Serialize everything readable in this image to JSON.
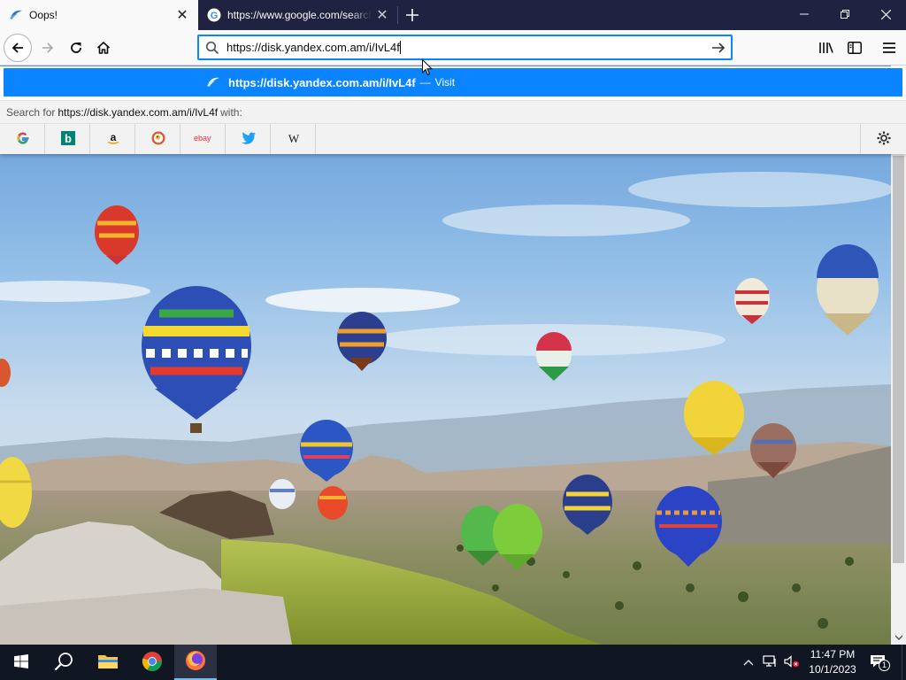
{
  "tabs": [
    {
      "title": "Oops!",
      "active": true
    },
    {
      "title": "https://www.google.com/search",
      "active": false
    }
  ],
  "navbar": {
    "url": "https://disk.yandex.com.am/i/IvL4f"
  },
  "dropdown": {
    "suggestion_url": "https://disk.yandex.com.am/i/IvL4f",
    "suggestion_separator": "—",
    "suggestion_action": "Visit",
    "search_prefix": "Search for",
    "search_term": "https://disk.yandex.com.am/i/IvL4f",
    "search_suffix": "with:",
    "engines": [
      "google-icon",
      "bing-icon",
      "amazon-icon",
      "duckduckgo-icon",
      "ebay-icon",
      "twitter-icon",
      "wikipedia-icon"
    ],
    "engine_glyphs": {
      "amazon": "a",
      "ebay": "ebay",
      "wikipedia": "W",
      "bing": "b"
    }
  },
  "taskbar": {
    "time": "11:47 PM",
    "date": "10/1/2023",
    "notification_count": "1"
  },
  "colors": {
    "accent": "#0a84ff",
    "tabstrip": "#1f2240",
    "taskbar": "#101622"
  }
}
